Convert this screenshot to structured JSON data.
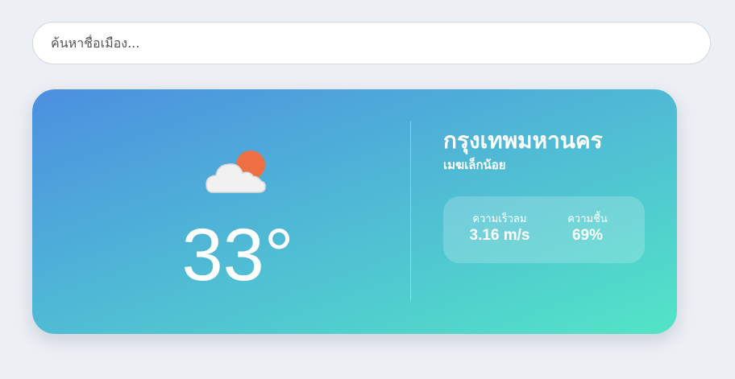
{
  "search": {
    "placeholder": "ค้นหาชื่อเมือง..."
  },
  "weather": {
    "icon": "sun-behind-cloud-icon",
    "temperature": "33°",
    "city": "กรุงเทพมหานคร",
    "description": "เมฆเล็กน้อย",
    "wind": {
      "label": "ความเร็วลม",
      "value": "3.16 m/s"
    },
    "humidity": {
      "label": "ความชื้น",
      "value": "69%"
    }
  },
  "colors": {
    "background": "#eceff4",
    "card_gradient_start": "#4c8fe0",
    "card_gradient_end": "#52e5c6",
    "sun": "#ef6f45",
    "cloud": "#f1f1f1"
  }
}
